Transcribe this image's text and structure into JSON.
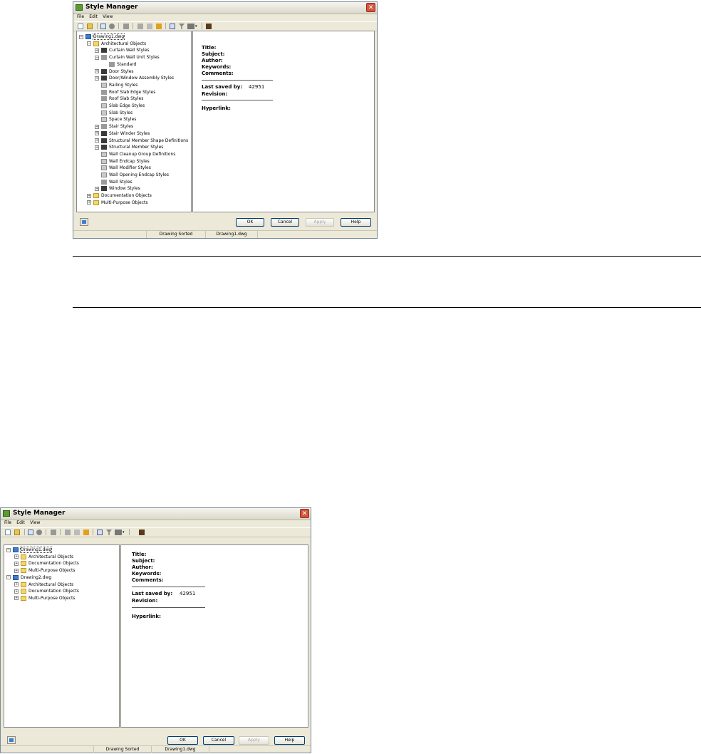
{
  "window_title": "Style Manager",
  "menu": [
    "File",
    "Edit",
    "View"
  ],
  "buttons": {
    "ok": "OK",
    "cancel": "Cancel",
    "apply": "Apply",
    "help": "Help"
  },
  "properties": {
    "title": "Title:",
    "subject": "Subject:",
    "author": "Author:",
    "keywords": "Keywords:",
    "comments": "Comments:",
    "last_saved_by": "Last saved by:",
    "last_saved_value": "42951",
    "revision": "Revision:",
    "hyperlink": "Hyperlink:"
  },
  "status": {
    "sort": "Drawing Sorted",
    "file": "Drawing1.dwg"
  },
  "dialog1_tree": [
    {
      "label": "Drawing1.dwg",
      "icon": "drawing-icon",
      "expander": "minus",
      "selected": true
    },
    {
      "label": "Architectural Objects",
      "icon": "folder-icon",
      "expander": "minus"
    },
    {
      "label": "Curtain Wall Styles",
      "icon": "curtain-wall-icon",
      "expander": "plus"
    },
    {
      "label": "Curtain Wall Unit Styles",
      "icon": "curtain-wall-unit-icon",
      "expander": "minus"
    },
    {
      "label": "Standard",
      "icon": "style-icon",
      "expander": ""
    },
    {
      "label": "Door Styles",
      "icon": "door-icon",
      "expander": "plus"
    },
    {
      "label": "Door/Window Assembly Styles",
      "icon": "door-window-assembly-icon",
      "expander": "plus"
    },
    {
      "label": "Railing Styles",
      "icon": "railing-icon",
      "expander": ""
    },
    {
      "label": "Roof Slab Edge Styles",
      "icon": "roof-slab-edge-icon",
      "expander": ""
    },
    {
      "label": "Roof Slab Styles",
      "icon": "roof-slab-icon",
      "expander": ""
    },
    {
      "label": "Slab Edge Styles",
      "icon": "slab-edge-icon",
      "expander": ""
    },
    {
      "label": "Slab Styles",
      "icon": "slab-icon",
      "expander": ""
    },
    {
      "label": "Space Styles",
      "icon": "space-icon",
      "expander": ""
    },
    {
      "label": "Stair Styles",
      "icon": "stair-icon",
      "expander": "plus"
    },
    {
      "label": "Stair Winder Styles",
      "icon": "stair-winder-icon",
      "expander": "plus"
    },
    {
      "label": "Structural Member Shape Definitions",
      "icon": "member-shape-icon",
      "expander": "plus"
    },
    {
      "label": "Structural Member Styles",
      "icon": "structural-member-icon",
      "expander": "plus"
    },
    {
      "label": "Wall Cleanup Group Definitions",
      "icon": "wall-cleanup-icon",
      "expander": ""
    },
    {
      "label": "Wall Endcap Styles",
      "icon": "wall-endcap-icon",
      "expander": ""
    },
    {
      "label": "Wall Modifier Styles",
      "icon": "wall-modifier-icon",
      "expander": ""
    },
    {
      "label": "Wall Opening Endcap Styles",
      "icon": "wall-opening-endcap-icon",
      "expander": ""
    },
    {
      "label": "Wall Styles",
      "icon": "wall-icon",
      "expander": ""
    },
    {
      "label": "Window Styles",
      "icon": "window-icon",
      "expander": "plus"
    },
    {
      "label": "Documentation Objects",
      "icon": "folder-icon",
      "expander": "plus"
    },
    {
      "label": "Multi-Purpose Objects",
      "icon": "folder-icon",
      "expander": "plus"
    }
  ],
  "dialog2_tree": [
    {
      "label": "Drawing1.dwg",
      "icon": "drawing-icon",
      "expander": "minus",
      "selected": true
    },
    {
      "label": "Architectural Objects",
      "icon": "folder-icon",
      "expander": "plus"
    },
    {
      "label": "Documentation Objects",
      "icon": "folder-icon",
      "expander": "plus"
    },
    {
      "label": "Multi-Purpose Objects",
      "icon": "folder-icon",
      "expander": "plus"
    },
    {
      "label": "Drawing2.dwg",
      "icon": "drawing-icon",
      "expander": "minus"
    },
    {
      "label": "Architectural Objects",
      "icon": "folder-icon",
      "expander": "plus"
    },
    {
      "label": "Documentation Objects",
      "icon": "folder-icon",
      "expander": "plus"
    },
    {
      "label": "Multi-Purpose Objects",
      "icon": "folder-icon",
      "expander": "plus"
    }
  ],
  "toolbar_icons": [
    "new-icon",
    "open-icon",
    "copy-icon",
    "paste-icon",
    "edit-icon",
    "purge-icon",
    "sort-icon",
    "filter-icon",
    "view-icon",
    "display-icon"
  ]
}
